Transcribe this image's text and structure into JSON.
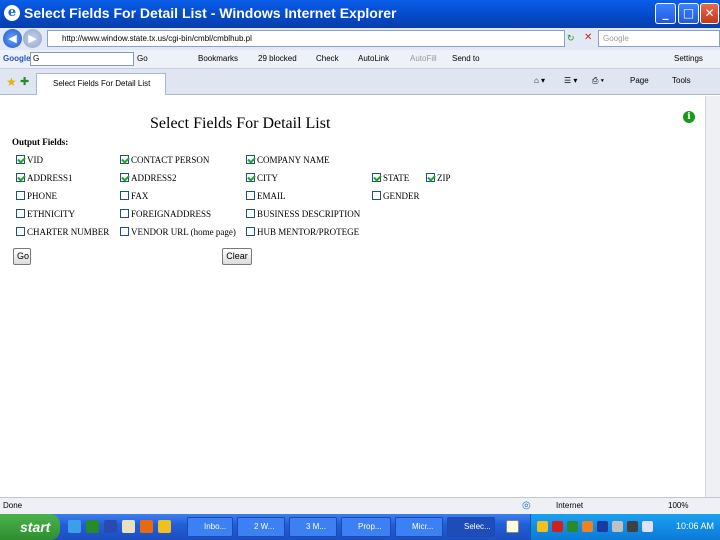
{
  "window": {
    "title": "Select Fields For Detail List - Windows Internet Explorer",
    "minimize": "_",
    "maximize": "□",
    "close": "✕"
  },
  "address": {
    "url": "http://www.window.state.tx.us/cgi-bin/cmbl/cmblhub.pl",
    "search_placeholder": "Google",
    "settings": "Settings"
  },
  "google_toolbar": {
    "label": "Google",
    "query": "G",
    "go": "Go",
    "bookmarks": "Bookmarks",
    "blocked": "29 blocked",
    "check": "Check",
    "autolink": "AutoLink",
    "autofill": "AutoFill",
    "sendto": "Send to"
  },
  "tab": {
    "label": "Select Fields For Detail List",
    "page": "Page",
    "tools": "Tools"
  },
  "page": {
    "title": "Select Fields For Detail List",
    "output_label": "Output Fields:",
    "fields": [
      {
        "label": "VID",
        "checked": true
      },
      {
        "label": "CONTACT PERSON",
        "checked": true
      },
      {
        "label": "COMPANY NAME",
        "checked": true
      },
      {
        "label": "ADDRESS1",
        "checked": true
      },
      {
        "label": "ADDRESS2",
        "checked": true
      },
      {
        "label": "CITY",
        "checked": true
      },
      {
        "label": "STATE",
        "checked": true
      },
      {
        "label": "ZIP",
        "checked": true
      },
      {
        "label": "PHONE",
        "checked": false
      },
      {
        "label": "FAX",
        "checked": false
      },
      {
        "label": "EMAIL",
        "checked": false
      },
      {
        "label": "GENDER",
        "checked": false
      },
      {
        "label": "ETHNICITY",
        "checked": false
      },
      {
        "label": "FOREIGNADDRESS",
        "checked": false
      },
      {
        "label": "BUSINESS DESCRIPTION",
        "checked": false
      },
      {
        "label": "CHARTER NUMBER",
        "checked": false
      },
      {
        "label": "VENDOR URL (home page)",
        "checked": false
      },
      {
        "label": "HUB MENTOR/PROTEGE",
        "checked": false
      }
    ],
    "go_button": "Go",
    "clear_button": "Clear"
  },
  "status": {
    "text": "Done",
    "zone": "Internet",
    "zoom": "100%"
  },
  "taskbar": {
    "start": "start",
    "tasks": [
      "Inbo...",
      "2 W...",
      "3 M...",
      "Prop...",
      "Micr...",
      "Selec..."
    ],
    "clock": "10:06 AM"
  }
}
